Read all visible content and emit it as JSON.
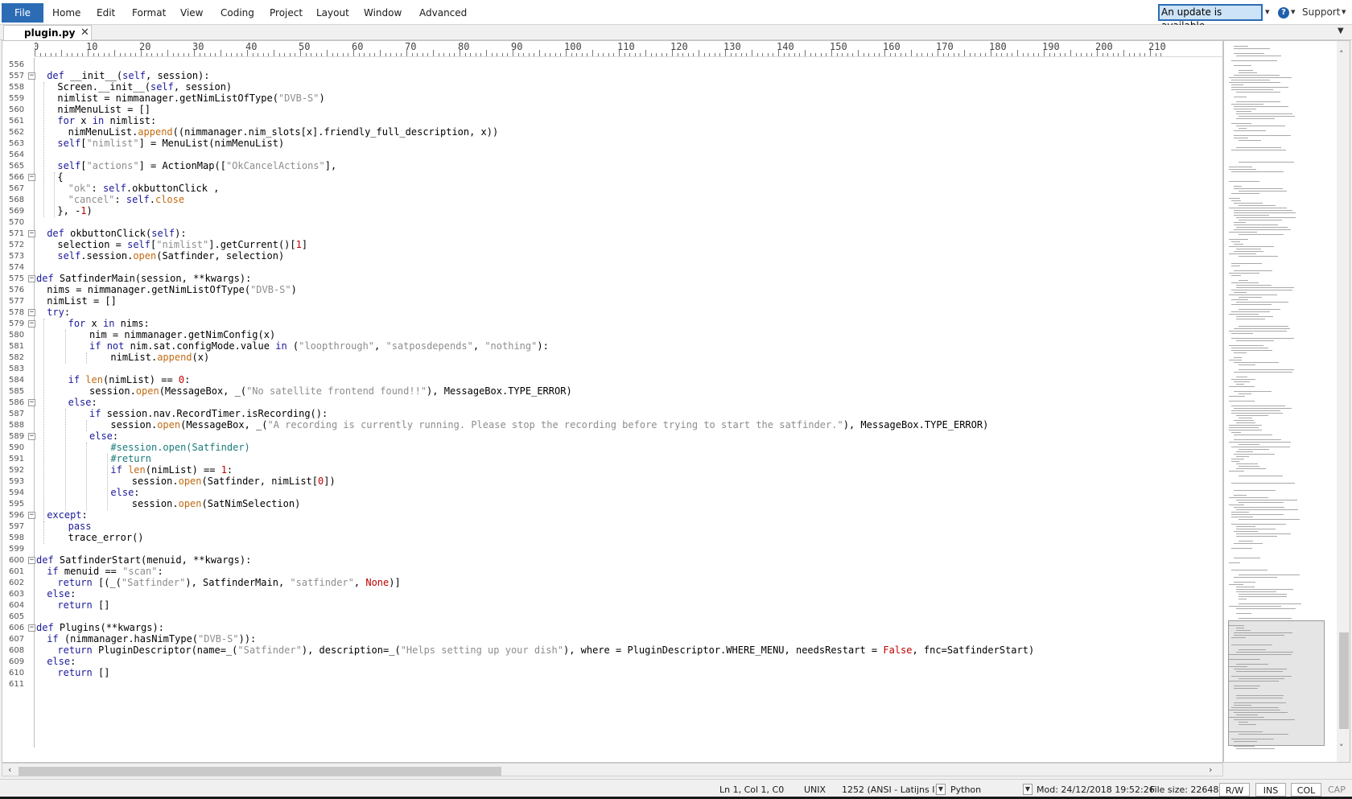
{
  "menubar": {
    "file": "File",
    "items": [
      "Home",
      "Edit",
      "Format",
      "View",
      "Coding",
      "Project",
      "Layout",
      "Window",
      "Advanced"
    ],
    "update_notice": "An update is available...",
    "support": "Support"
  },
  "tab": {
    "label": "plugin.py",
    "close": "✕"
  },
  "ruler": {
    "labels": [
      "0",
      "10",
      "20",
      "30",
      "40",
      "50",
      "60",
      "70",
      "80",
      "90",
      "100",
      "110",
      "120",
      "130",
      "140",
      "150",
      "160",
      "170",
      "180",
      "190",
      "200",
      "210"
    ]
  },
  "code": {
    "lines": [
      {
        "num": "556",
        "text": ""
      },
      {
        "num": "557",
        "text": "def __init__(self, session):"
      },
      {
        "num": "558",
        "text": "Screen.__init__(self, session)"
      },
      {
        "num": "559",
        "text": "nimlist = nimmanager.getNimListOfType(\"DVB-S\")"
      },
      {
        "num": "560",
        "text": "nimMenuList = []"
      },
      {
        "num": "561",
        "text": "for x in nimlist:"
      },
      {
        "num": "562",
        "text": "nimMenuList.append((nimmanager.nim_slots[x].friendly_full_description, x))"
      },
      {
        "num": "563",
        "text": "self[\"nimlist\"] = MenuList(nimMenuList)"
      },
      {
        "num": "564",
        "text": ""
      },
      {
        "num": "565",
        "text": "self[\"actions\"] = ActionMap([\"OkCancelActions\"],"
      },
      {
        "num": "566",
        "text": "{"
      },
      {
        "num": "567",
        "text": "\"ok\": self.okbuttonClick ,"
      },
      {
        "num": "568",
        "text": "\"cancel\": self.close"
      },
      {
        "num": "569",
        "text": "}, -1)"
      },
      {
        "num": "570",
        "text": ""
      },
      {
        "num": "571",
        "text": "def okbuttonClick(self):"
      },
      {
        "num": "572",
        "text": "selection = self[\"nimlist\"].getCurrent()[1]"
      },
      {
        "num": "573",
        "text": "self.session.open(Satfinder, selection)"
      },
      {
        "num": "574",
        "text": ""
      },
      {
        "num": "575",
        "text": "def SatfinderMain(session, **kwargs):"
      },
      {
        "num": "576",
        "text": "nims = nimmanager.getNimListOfType(\"DVB-S\")"
      },
      {
        "num": "577",
        "text": "nimList = []"
      },
      {
        "num": "578",
        "text": "try:"
      },
      {
        "num": "579",
        "text": "for x in nims:"
      },
      {
        "num": "580",
        "text": "nim = nimmanager.getNimConfig(x)"
      },
      {
        "num": "581",
        "text": "if not nim.sat.configMode.value in (\"loopthrough\", \"satposdepends\", \"nothing\"):"
      },
      {
        "num": "582",
        "text": "nimList.append(x)"
      },
      {
        "num": "583",
        "text": ""
      },
      {
        "num": "584",
        "text": "if len(nimList) == 0:"
      },
      {
        "num": "585",
        "text": "session.open(MessageBox, _(\"No satellite frontend found!!\"), MessageBox.TYPE_ERROR)"
      },
      {
        "num": "586",
        "text": "else:"
      },
      {
        "num": "587",
        "text": "if session.nav.RecordTimer.isRecording():"
      },
      {
        "num": "588",
        "text": "session.open(MessageBox, _(\"A recording is currently running. Please stop the recording before trying to start the satfinder.\"), MessageBox.TYPE_ERROR)"
      },
      {
        "num": "589",
        "text": "else:"
      },
      {
        "num": "590",
        "text": "#session.open(Satfinder)"
      },
      {
        "num": "591",
        "text": "#return"
      },
      {
        "num": "592",
        "text": "if len(nimList) == 1:"
      },
      {
        "num": "593",
        "text": "session.open(Satfinder, nimList[0])"
      },
      {
        "num": "594",
        "text": "else:"
      },
      {
        "num": "595",
        "text": "session.open(SatNimSelection)"
      },
      {
        "num": "596",
        "text": "except:"
      },
      {
        "num": "597",
        "text": "pass"
      },
      {
        "num": "598",
        "text": "trace_error()"
      },
      {
        "num": "599",
        "text": ""
      },
      {
        "num": "600",
        "text": "def SatfinderStart(menuid, **kwargs):"
      },
      {
        "num": "601",
        "text": "if menuid == \"scan\":"
      },
      {
        "num": "602",
        "text": "return [(_(\"Satfinder\"), SatfinderMain, \"satfinder\", None)]"
      },
      {
        "num": "603",
        "text": "else:"
      },
      {
        "num": "604",
        "text": "return []"
      },
      {
        "num": "605",
        "text": ""
      },
      {
        "num": "606",
        "text": "def Plugins(**kwargs):"
      },
      {
        "num": "607",
        "text": "if (nimmanager.hasNimType(\"DVB-S\")):"
      },
      {
        "num": "608",
        "text": "return PluginDescriptor(name=_(\"Satfinder\"), description=_(\"Helps setting up your dish\"), where = PluginDescriptor.WHERE_MENU, needsRestart = False, fnc=SatfinderStart)"
      },
      {
        "num": "609",
        "text": "else:"
      },
      {
        "num": "610",
        "text": "return []"
      },
      {
        "num": "611",
        "text": ""
      }
    ]
  },
  "statusbar": {
    "position": "Ln 1, Col 1, C0",
    "line_ending": "UNIX",
    "encoding": "1252  (ANSI - Latijns I)",
    "language": "Python",
    "modified": "Mod: 24/12/2018 19:52:26",
    "file_size": "File size: 22648",
    "rw": "R/W",
    "ins": "INS",
    "col": "COL",
    "cap": "CAP"
  }
}
